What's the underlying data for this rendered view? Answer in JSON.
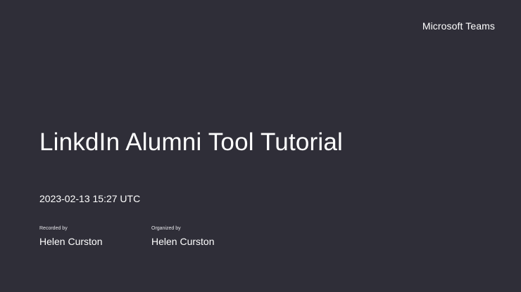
{
  "header": {
    "brand": "Microsoft Teams"
  },
  "recording": {
    "title": "LinkdIn Alumni Tool Tutorial",
    "datetime": "2023-02-13 15:27 UTC",
    "recorded_by_label": "Recorded by",
    "recorded_by": "Helen Curston",
    "organized_by_label": "Organized by",
    "organized_by": "Helen Curston"
  },
  "colors": {
    "background": "#2f2e38",
    "text": "#ffffff"
  }
}
